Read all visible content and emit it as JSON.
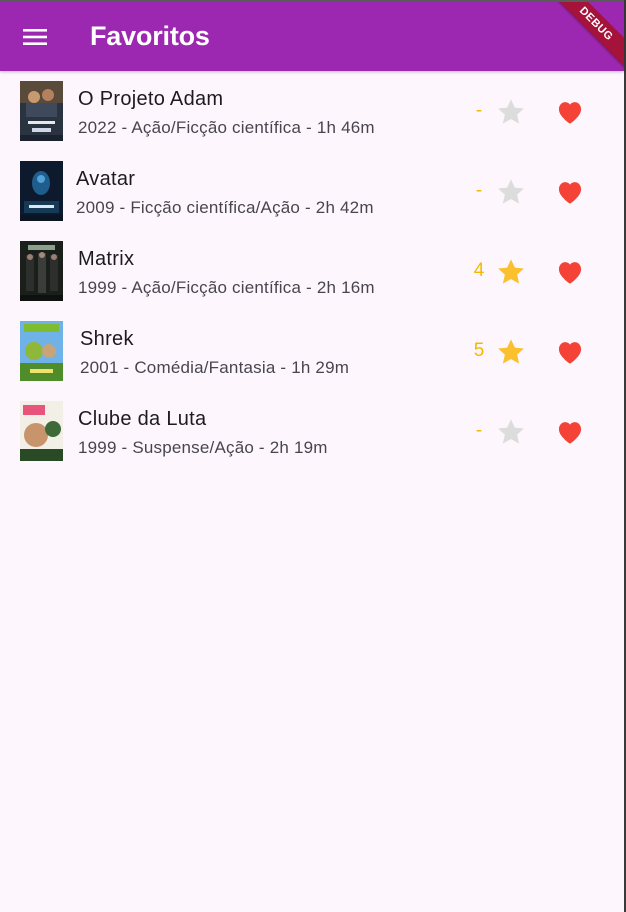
{
  "app_bar": {
    "title": "Favoritos",
    "menu_icon": "menu-icon",
    "debug_banner": "DEBUG",
    "color": "#9c27b0"
  },
  "colors": {
    "rating": "#f5b800",
    "star_active": "#fbc02d",
    "star_inactive": "#dcdcdc",
    "heart": "#f44336"
  },
  "movies": [
    {
      "title": "O Projeto Adam",
      "subtitle": "2022 - Ação/Ficção científica - 1h 46m",
      "rating": "-",
      "starred": false,
      "favorite": true
    },
    {
      "title": "Avatar",
      "subtitle": "2009 - Ficção científica/Ação - 2h 42m",
      "rating": "-",
      "starred": false,
      "favorite": true
    },
    {
      "title": "Matrix",
      "subtitle": "1999 - Ação/Ficção científica - 2h 16m",
      "rating": "4",
      "starred": true,
      "favorite": true
    },
    {
      "title": "Shrek",
      "subtitle": "2001 - Comédia/Fantasia - 1h 29m",
      "rating": "5",
      "starred": true,
      "favorite": true
    },
    {
      "title": "Clube da Luta",
      "subtitle": "1999 - Suspense/Ação - 2h 19m",
      "rating": "-",
      "starred": false,
      "favorite": true
    }
  ]
}
